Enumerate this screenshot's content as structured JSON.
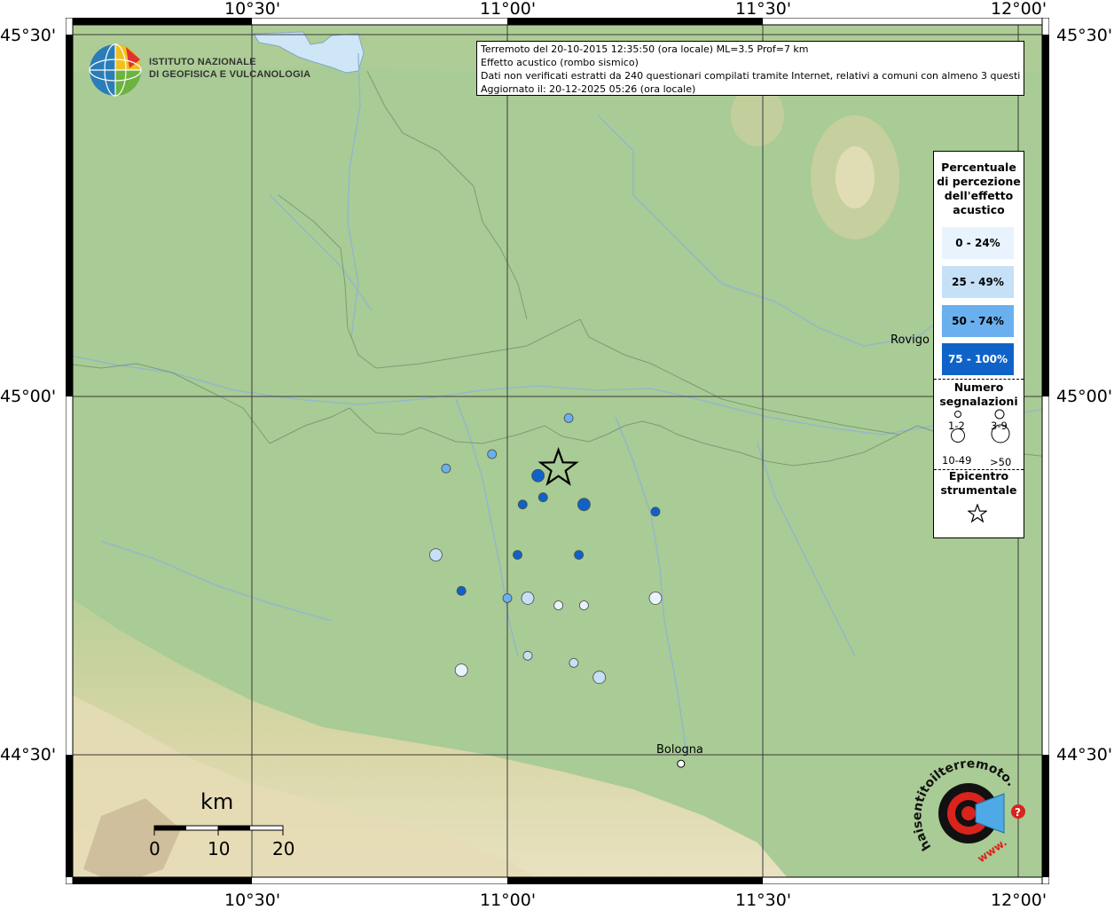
{
  "header": {
    "line1": "Terremoto del 20-10-2015 12:35:50 (ora locale) ML=3.5 Prof=7 km",
    "line2": "Effetto acustico (rombo sismico)",
    "line3": "Dati non verificati estratti da 240 questionari compilati tramite Internet, relativi a comuni con almeno 3 questionari.",
    "line4": "Aggiornato il: 20-12-2025 05:26 (ora locale)"
  },
  "axes": {
    "top": [
      "10°30'",
      "11°00'",
      "11°30'",
      "12°00'"
    ],
    "bottom": [
      "10°30'",
      "11°00'",
      "11°30'",
      "12°00'"
    ],
    "left": [
      "45°30'",
      "45°00'",
      "44°30'"
    ],
    "right": [
      "45°30'",
      "45°00'",
      "44°30'"
    ]
  },
  "institute": {
    "line1": "ISTITUTO NAZIONALE",
    "line2": "DI GEOFISICA E VULCANOLOGIA"
  },
  "cities": {
    "rovigo": "Rovigo",
    "bologna": "Bologna"
  },
  "legend": {
    "title": [
      "Percentuale",
      "di percezione",
      "dell'effetto",
      "acustico"
    ],
    "classes": [
      {
        "label": "0 - 24%",
        "color": "#e8f3fd",
        "text_color": "#000000"
      },
      {
        "label": "25 - 49%",
        "color": "#c6e0f8",
        "text_color": "#000000"
      },
      {
        "label": "50 - 74%",
        "color": "#6ab0ef",
        "text_color": "#000000"
      },
      {
        "label": "75 - 100%",
        "color": "#0f63c8",
        "text_color": "#ffffff"
      }
    ],
    "count_title": [
      "Numero",
      "segnalazioni"
    ],
    "count_classes": [
      "1-2",
      "3-9",
      "10-49",
      ">50"
    ],
    "epicenter_title": [
      "Epicentro",
      "strumentale"
    ]
  },
  "scalebar": {
    "unit": "km",
    "ticks": [
      "0",
      "10",
      "20"
    ]
  },
  "logo_hst": {
    "text": "haisentitoilterremoto.it",
    "www": "www.",
    "question": "?"
  },
  "colors": {
    "plain": "#a9cb95",
    "hills": "#d9d6a8",
    "water": "#cfe6f7",
    "marker_low": "#e8f3fd",
    "marker_mid": "#c6e0f8",
    "marker_high": "#6ab0ef",
    "marker_top": "#0f63c8"
  },
  "observations": [
    {
      "lon": 11.12,
      "lat": 44.97,
      "pct_class": 2,
      "size_class": 1
    },
    {
      "lon": 10.97,
      "lat": 44.92,
      "pct_class": 2,
      "size_class": 1
    },
    {
      "lon": 10.88,
      "lat": 44.9,
      "pct_class": 2,
      "size_class": 1
    },
    {
      "lon": 11.06,
      "lat": 44.89,
      "pct_class": 3,
      "size_class": 2
    },
    {
      "lon": 11.03,
      "lat": 44.85,
      "pct_class": 3,
      "size_class": 1
    },
    {
      "lon": 11.07,
      "lat": 44.86,
      "pct_class": 3,
      "size_class": 1
    },
    {
      "lon": 11.15,
      "lat": 44.85,
      "pct_class": 3,
      "size_class": 2
    },
    {
      "lon": 11.29,
      "lat": 44.84,
      "pct_class": 3,
      "size_class": 1
    },
    {
      "lon": 10.86,
      "lat": 44.78,
      "pct_class": 1,
      "size_class": 2
    },
    {
      "lon": 11.02,
      "lat": 44.78,
      "pct_class": 3,
      "size_class": 1
    },
    {
      "lon": 11.14,
      "lat": 44.78,
      "pct_class": 3,
      "size_class": 1
    },
    {
      "lon": 10.91,
      "lat": 44.73,
      "pct_class": 3,
      "size_class": 1
    },
    {
      "lon": 11.0,
      "lat": 44.72,
      "pct_class": 2,
      "size_class": 1
    },
    {
      "lon": 11.04,
      "lat": 44.72,
      "pct_class": 1,
      "size_class": 2
    },
    {
      "lon": 11.1,
      "lat": 44.71,
      "pct_class": 0,
      "size_class": 1
    },
    {
      "lon": 11.15,
      "lat": 44.71,
      "pct_class": 0,
      "size_class": 1
    },
    {
      "lon": 11.29,
      "lat": 44.72,
      "pct_class": 0,
      "size_class": 2
    },
    {
      "lon": 11.04,
      "lat": 44.64,
      "pct_class": 1,
      "size_class": 1
    },
    {
      "lon": 11.13,
      "lat": 44.63,
      "pct_class": 1,
      "size_class": 1
    },
    {
      "lon": 10.91,
      "lat": 44.62,
      "pct_class": 0,
      "size_class": 2
    },
    {
      "lon": 11.18,
      "lat": 44.61,
      "pct_class": 1,
      "size_class": 2
    }
  ],
  "epicenter": {
    "lon": 11.1,
    "lat": 44.9
  },
  "bologna_point": {
    "lon": 11.34,
    "lat": 44.49
  }
}
